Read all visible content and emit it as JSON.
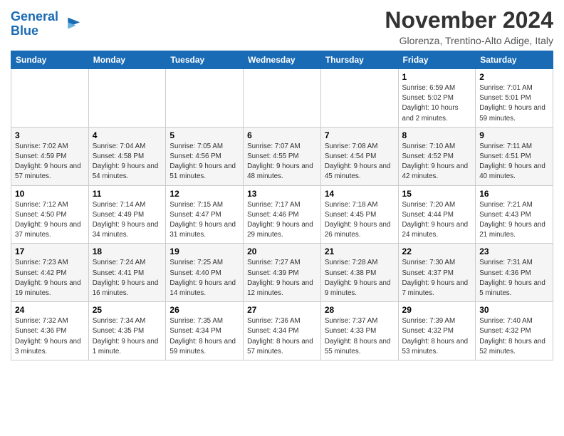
{
  "logo": {
    "line1": "General",
    "line2": "Blue"
  },
  "title": "November 2024",
  "subtitle": "Glorenza, Trentino-Alto Adige, Italy",
  "days_of_week": [
    "Sunday",
    "Monday",
    "Tuesday",
    "Wednesday",
    "Thursday",
    "Friday",
    "Saturday"
  ],
  "weeks": [
    [
      {
        "day": "",
        "info": ""
      },
      {
        "day": "",
        "info": ""
      },
      {
        "day": "",
        "info": ""
      },
      {
        "day": "",
        "info": ""
      },
      {
        "day": "",
        "info": ""
      },
      {
        "day": "1",
        "info": "Sunrise: 6:59 AM\nSunset: 5:02 PM\nDaylight: 10 hours and 2 minutes."
      },
      {
        "day": "2",
        "info": "Sunrise: 7:01 AM\nSunset: 5:01 PM\nDaylight: 9 hours and 59 minutes."
      }
    ],
    [
      {
        "day": "3",
        "info": "Sunrise: 7:02 AM\nSunset: 4:59 PM\nDaylight: 9 hours and 57 minutes."
      },
      {
        "day": "4",
        "info": "Sunrise: 7:04 AM\nSunset: 4:58 PM\nDaylight: 9 hours and 54 minutes."
      },
      {
        "day": "5",
        "info": "Sunrise: 7:05 AM\nSunset: 4:56 PM\nDaylight: 9 hours and 51 minutes."
      },
      {
        "day": "6",
        "info": "Sunrise: 7:07 AM\nSunset: 4:55 PM\nDaylight: 9 hours and 48 minutes."
      },
      {
        "day": "7",
        "info": "Sunrise: 7:08 AM\nSunset: 4:54 PM\nDaylight: 9 hours and 45 minutes."
      },
      {
        "day": "8",
        "info": "Sunrise: 7:10 AM\nSunset: 4:52 PM\nDaylight: 9 hours and 42 minutes."
      },
      {
        "day": "9",
        "info": "Sunrise: 7:11 AM\nSunset: 4:51 PM\nDaylight: 9 hours and 40 minutes."
      }
    ],
    [
      {
        "day": "10",
        "info": "Sunrise: 7:12 AM\nSunset: 4:50 PM\nDaylight: 9 hours and 37 minutes."
      },
      {
        "day": "11",
        "info": "Sunrise: 7:14 AM\nSunset: 4:49 PM\nDaylight: 9 hours and 34 minutes."
      },
      {
        "day": "12",
        "info": "Sunrise: 7:15 AM\nSunset: 4:47 PM\nDaylight: 9 hours and 31 minutes."
      },
      {
        "day": "13",
        "info": "Sunrise: 7:17 AM\nSunset: 4:46 PM\nDaylight: 9 hours and 29 minutes."
      },
      {
        "day": "14",
        "info": "Sunrise: 7:18 AM\nSunset: 4:45 PM\nDaylight: 9 hours and 26 minutes."
      },
      {
        "day": "15",
        "info": "Sunrise: 7:20 AM\nSunset: 4:44 PM\nDaylight: 9 hours and 24 minutes."
      },
      {
        "day": "16",
        "info": "Sunrise: 7:21 AM\nSunset: 4:43 PM\nDaylight: 9 hours and 21 minutes."
      }
    ],
    [
      {
        "day": "17",
        "info": "Sunrise: 7:23 AM\nSunset: 4:42 PM\nDaylight: 9 hours and 19 minutes."
      },
      {
        "day": "18",
        "info": "Sunrise: 7:24 AM\nSunset: 4:41 PM\nDaylight: 9 hours and 16 minutes."
      },
      {
        "day": "19",
        "info": "Sunrise: 7:25 AM\nSunset: 4:40 PM\nDaylight: 9 hours and 14 minutes."
      },
      {
        "day": "20",
        "info": "Sunrise: 7:27 AM\nSunset: 4:39 PM\nDaylight: 9 hours and 12 minutes."
      },
      {
        "day": "21",
        "info": "Sunrise: 7:28 AM\nSunset: 4:38 PM\nDaylight: 9 hours and 9 minutes."
      },
      {
        "day": "22",
        "info": "Sunrise: 7:30 AM\nSunset: 4:37 PM\nDaylight: 9 hours and 7 minutes."
      },
      {
        "day": "23",
        "info": "Sunrise: 7:31 AM\nSunset: 4:36 PM\nDaylight: 9 hours and 5 minutes."
      }
    ],
    [
      {
        "day": "24",
        "info": "Sunrise: 7:32 AM\nSunset: 4:36 PM\nDaylight: 9 hours and 3 minutes."
      },
      {
        "day": "25",
        "info": "Sunrise: 7:34 AM\nSunset: 4:35 PM\nDaylight: 9 hours and 1 minute."
      },
      {
        "day": "26",
        "info": "Sunrise: 7:35 AM\nSunset: 4:34 PM\nDaylight: 8 hours and 59 minutes."
      },
      {
        "day": "27",
        "info": "Sunrise: 7:36 AM\nSunset: 4:34 PM\nDaylight: 8 hours and 57 minutes."
      },
      {
        "day": "28",
        "info": "Sunrise: 7:37 AM\nSunset: 4:33 PM\nDaylight: 8 hours and 55 minutes."
      },
      {
        "day": "29",
        "info": "Sunrise: 7:39 AM\nSunset: 4:32 PM\nDaylight: 8 hours and 53 minutes."
      },
      {
        "day": "30",
        "info": "Sunrise: 7:40 AM\nSunset: 4:32 PM\nDaylight: 8 hours and 52 minutes."
      }
    ]
  ]
}
